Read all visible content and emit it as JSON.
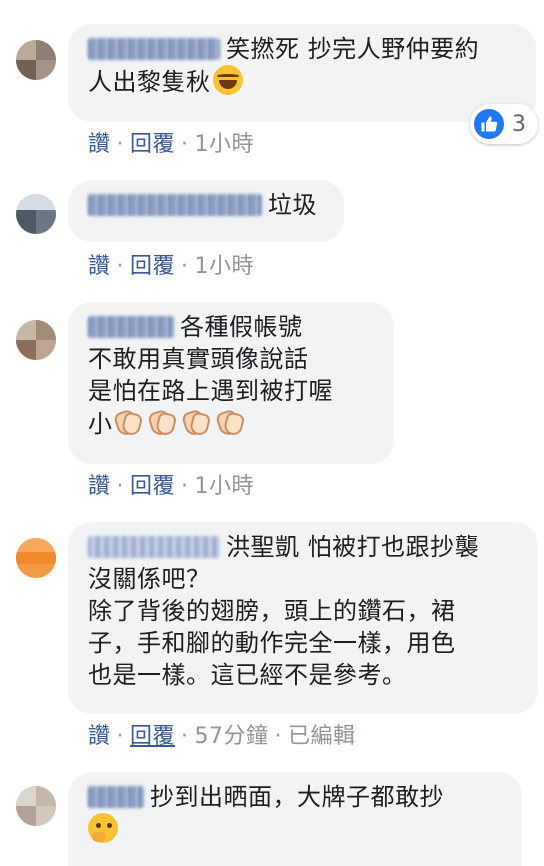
{
  "comments": [
    {
      "lines": [
        "笑撚死 抄完人野仲要約",
        "人出黎隻秋"
      ],
      "line_end_emoji": "laughing-emoji",
      "actions": {
        "like": "讚",
        "sep1": "·",
        "reply": "回覆",
        "sep2": "·",
        "time": "1小時"
      },
      "reaction": {
        "icon": "thumbs-up-icon",
        "count": "3",
        "color": "#2078f4"
      }
    },
    {
      "lines": [
        "垃圾"
      ],
      "actions": {
        "like": "讚",
        "sep1": "·",
        "reply": "回覆",
        "sep2": "·",
        "time": "1小時"
      }
    },
    {
      "lines": [
        "各種假帳號",
        "不敢用真實頭像說話",
        "是怕在路上遇到被打喔",
        "小"
      ],
      "line_end_emoji": "clapping-hands-emoji",
      "actions": {
        "like": "讚",
        "sep1": "·",
        "reply": "回覆",
        "sep2": "·",
        "time": "1小時"
      }
    },
    {
      "lines": [
        "洪聖凱 怕被打也跟抄襲",
        "沒關係吧？",
        "除了背後的翅膀，頭上的鑽石，裙",
        "子，手和腳的動作完全一樣，用色",
        "也是一樣。這已經不是參考。"
      ],
      "actions": {
        "like": "讚",
        "sep1": "·",
        "reply": "回覆",
        "sep2": "·",
        "time": "57分鐘",
        "sep3": "·",
        "edited": "已編輯"
      }
    },
    {
      "lines": [
        "抄到出晒面，大牌子都敢抄"
      ],
      "line_end_emoji": "thinking-face-emoji",
      "actions": {}
    }
  ],
  "colors": {
    "link": "#385898",
    "muted": "#90949c",
    "bubble": "#f2f3f5",
    "like_blue": "#2078f4"
  }
}
